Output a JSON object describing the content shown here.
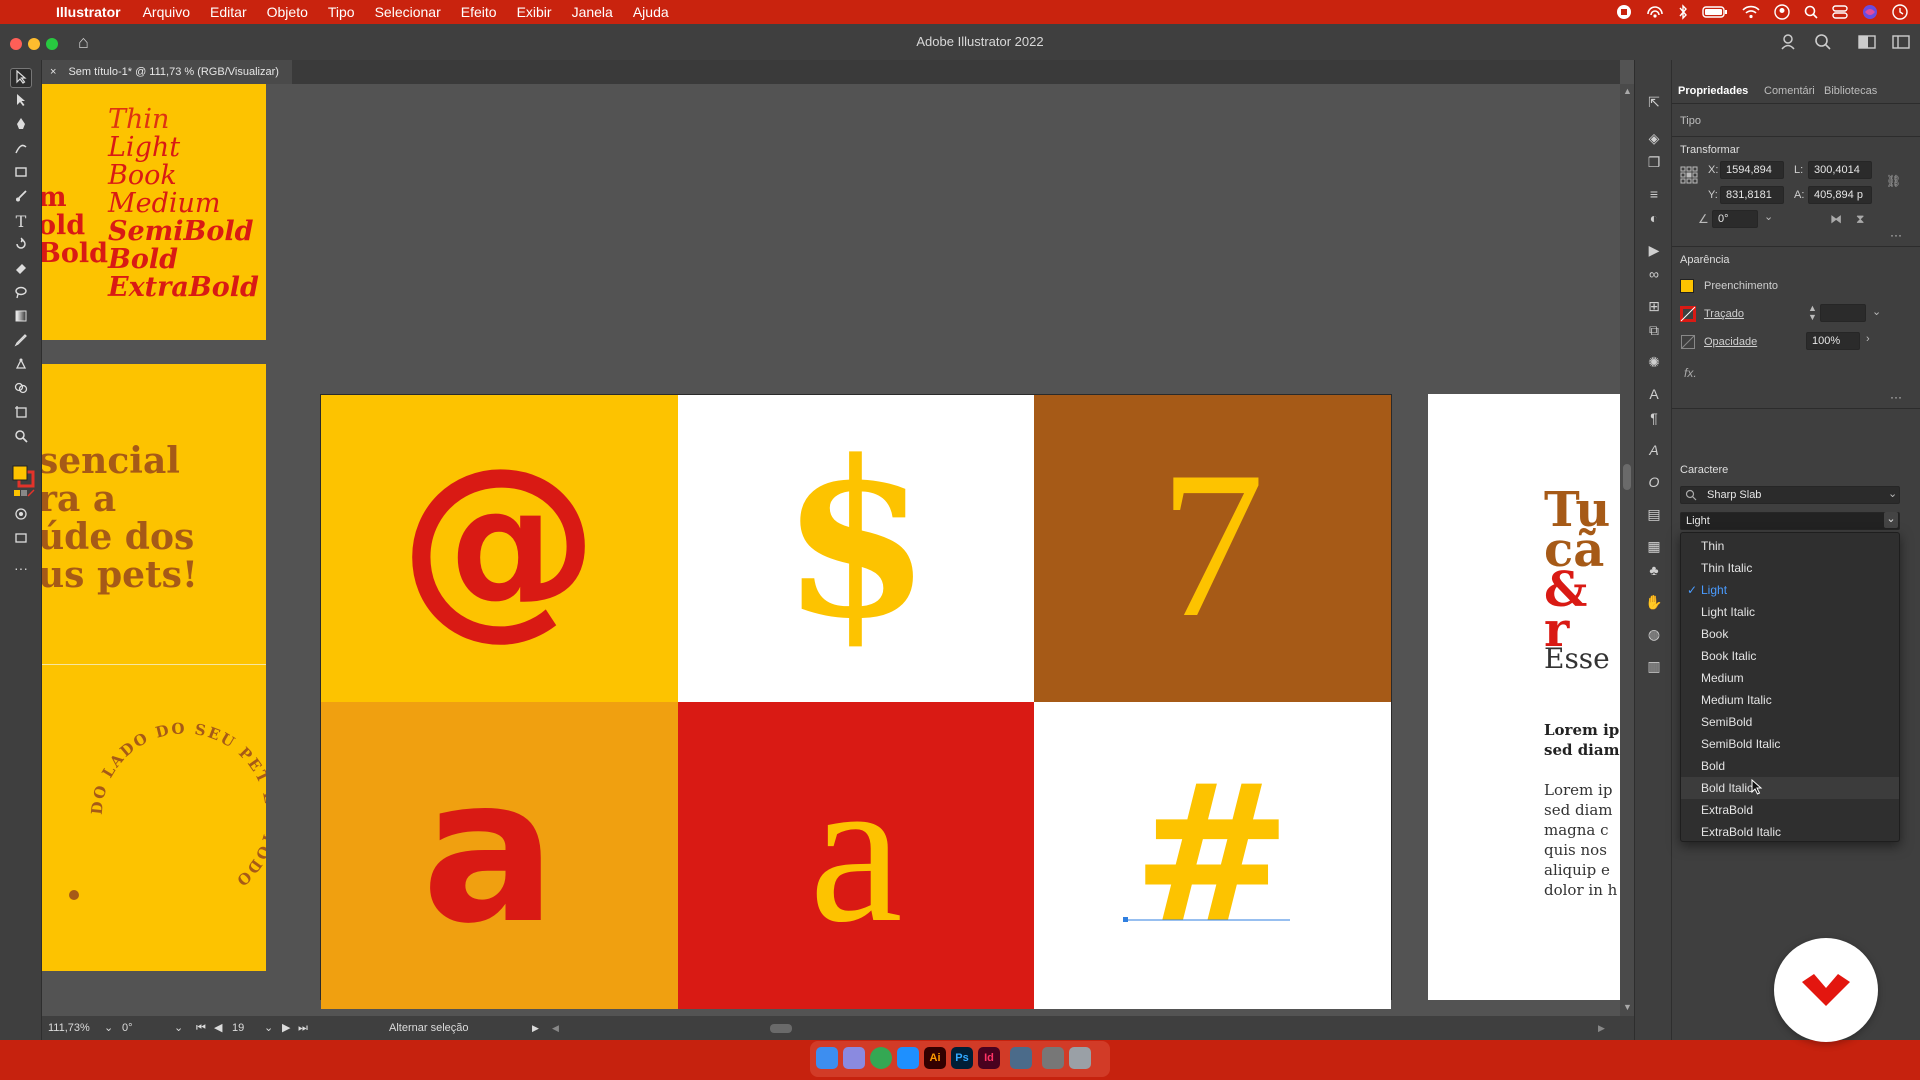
{
  "menubar": {
    "app_name": "Illustrator",
    "items": [
      "Arquivo",
      "Editar",
      "Objeto",
      "Tipo",
      "Selecionar",
      "Efeito",
      "Exibir",
      "Janela",
      "Ajuda"
    ],
    "apple_glyph": "",
    "status_icons": [
      "record-icon",
      "airdrop-icon",
      "bluetooth-icon",
      "battery-icon",
      "wifi-icon",
      "user-icon",
      "search-icon",
      "control-center-icon",
      "siri-icon",
      "clock-icon"
    ]
  },
  "window": {
    "title": "Adobe Illustrator 2022",
    "home_glyph": "⌂",
    "close_color": "#ff5f57",
    "minimize_color": "#febc2e",
    "zoom_color": "#28c840"
  },
  "document": {
    "tab_close": "×",
    "tab_label": "Sem título-1* @ 111,73 % (RGB/Visualizar)"
  },
  "artboard_left_top": {
    "weights_right": [
      "Thin",
      "Light",
      "Book",
      "Medium",
      "SemiBold",
      "Bold",
      "ExtraBold"
    ],
    "weights_left_partial": [
      "m",
      "old",
      "Bold"
    ]
  },
  "artboard_left_mid": {
    "lines": [
      "sencial",
      "ra a",
      "úde dos",
      "us pets!"
    ]
  },
  "artboard_left_bottom": {
    "arc_text": "DO LADO DO SEU PET EM TODO"
  },
  "artboard_main": {
    "cells": [
      {
        "glyph": "@",
        "bg": "#fdc300",
        "fg": "#d91a14",
        "style": "bold"
      },
      {
        "glyph": "$",
        "bg": "#ffffff",
        "fg": "#fdc300",
        "style": "bold"
      },
      {
        "glyph": "7",
        "bg": "#a65a17",
        "fg": "#fdc300",
        "style": "thin"
      },
      {
        "glyph": "a",
        "bg": "#f0a010",
        "fg": "#d91a14",
        "style": "bold"
      },
      {
        "glyph": "a",
        "bg": "#d91a14",
        "fg": "#fdc300",
        "style": "thin"
      },
      {
        "glyph": "#",
        "bg": "#ffffff",
        "fg": "#fdc300",
        "style": "bold"
      }
    ]
  },
  "artboard_right": {
    "headline": [
      "Tu",
      "cã",
      "& r"
    ],
    "subhead": "Esse",
    "bold_lines": [
      "Lorem ip",
      "sed diam"
    ],
    "body_lines": [
      "Lorem ip",
      "sed diam",
      "magna c",
      "quis nos",
      "aliquip e",
      "dolor in h"
    ]
  },
  "statusbar": {
    "zoom": "111,73%",
    "rotation": "0°",
    "artboard_number": "19",
    "message": "Alternar seleção"
  },
  "properties": {
    "tabs": [
      "Propriedades",
      "Comentári",
      "Bibliotecas"
    ],
    "object_type": "Tipo",
    "transform": {
      "title": "Transformar",
      "x_label": "X:",
      "x": "1594,894",
      "y_label": "Y:",
      "y": "831,8181",
      "w_label": "L:",
      "w": "300,4014",
      "h_label": "A:",
      "h": "405,894 p",
      "angle": "0°"
    },
    "appearance": {
      "title": "Aparência",
      "fill_label": "Preenchimento",
      "fill_color": "#fdc300",
      "stroke_label": "Traçado",
      "opacity_label": "Opacidade",
      "opacity": "100%",
      "fx": "fx."
    },
    "character": {
      "title": "Caractere",
      "font_family": "Sharp Slab",
      "font_style": "Light"
    }
  },
  "font_style_menu": {
    "items": [
      "Thin",
      "Thin Italic",
      "Light",
      "Light Italic",
      "Book",
      "Book Italic",
      "Medium",
      "Medium Italic",
      "SemiBold",
      "SemiBold Italic",
      "Bold",
      "Bold Italic",
      "ExtraBold",
      "ExtraBold Italic"
    ],
    "selected": "Light",
    "hovered": "Bold Italic",
    "check_glyph": "✓"
  },
  "dock": {
    "apps": [
      {
        "name": "finder-icon",
        "label": "",
        "bg": "#3d8ef0",
        "fg": "#ffffff"
      },
      {
        "name": "launchpad-icon",
        "label": "",
        "bg": "#8a8ae0",
        "fg": "#ffffff"
      },
      {
        "name": "chrome-icon",
        "label": "",
        "bg": "#34a853",
        "fg": "#ffffff"
      },
      {
        "name": "appstore-icon",
        "label": "",
        "bg": "#1e90ff",
        "fg": "#ffffff"
      },
      {
        "name": "illustrator-icon",
        "label": "Ai",
        "bg": "#330000",
        "fg": "#ff9a00"
      },
      {
        "name": "photoshop-icon",
        "label": "Ps",
        "bg": "#001e36",
        "fg": "#31a8ff"
      },
      {
        "name": "indesign-icon",
        "label": "Id",
        "bg": "#49021f",
        "fg": "#ff3366"
      },
      {
        "name": "preview-icon",
        "label": "",
        "bg": "#4b6b8a",
        "fg": "#ffffff"
      },
      {
        "name": "keyboard-icon",
        "label": "",
        "bg": "#777777",
        "fg": "#ffffff"
      },
      {
        "name": "trash-icon",
        "label": "",
        "bg": "#9aa0a6",
        "fg": "#ffffff"
      }
    ]
  }
}
